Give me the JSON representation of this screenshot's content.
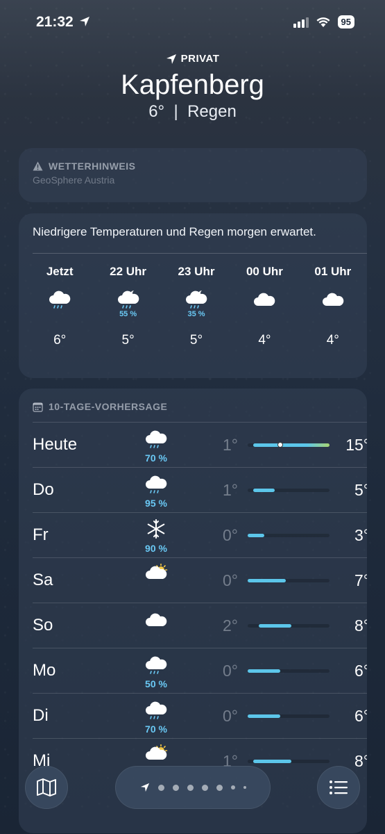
{
  "status": {
    "time": "21:32",
    "battery": "95"
  },
  "header": {
    "location_label": "PRIVAT",
    "city": "Kapfenberg",
    "temp": "6°",
    "separator": "|",
    "condition": "Regen"
  },
  "alert": {
    "title": "WETTERHINWEIS",
    "source": "GeoSphere Austria"
  },
  "hourly": {
    "description": "Niedrigere Temperaturen und Regen morgen erwartet.",
    "hours": [
      {
        "label": "Jetzt",
        "icon": "rain-cloud-icon",
        "pct": "",
        "temp": "6°"
      },
      {
        "label": "22 Uhr",
        "icon": "night-rain-icon",
        "pct": "55 %",
        "temp": "5°"
      },
      {
        "label": "23 Uhr",
        "icon": "night-rain-icon",
        "pct": "35 %",
        "temp": "5°"
      },
      {
        "label": "00 Uhr",
        "icon": "cloud-icon",
        "pct": "",
        "temp": "4°"
      },
      {
        "label": "01 Uhr",
        "icon": "cloud-icon",
        "pct": "",
        "temp": "4°"
      }
    ]
  },
  "forecast": {
    "title": "10-TAGE-VORHERSAGE",
    "range_min": 0,
    "range_max": 15,
    "days": [
      {
        "day": "Heute",
        "icon": "rain-cloud-icon",
        "pct": "70 %",
        "lo": "1°",
        "hi": "15°",
        "lo_v": 1,
        "hi_v": 15,
        "current": 6
      },
      {
        "day": "Do",
        "icon": "rain-cloud-icon",
        "pct": "95 %",
        "lo": "1°",
        "hi": "5°",
        "lo_v": 1,
        "hi_v": 5
      },
      {
        "day": "Fr",
        "icon": "snowflake-icon",
        "pct": "90 %",
        "lo": "0°",
        "hi": "3°",
        "lo_v": 0,
        "hi_v": 3
      },
      {
        "day": "Sa",
        "icon": "sun-cloud-icon",
        "pct": "",
        "lo": "0°",
        "hi": "7°",
        "lo_v": 0,
        "hi_v": 7
      },
      {
        "day": "So",
        "icon": "cloud-icon",
        "pct": "",
        "lo": "2°",
        "hi": "8°",
        "lo_v": 2,
        "hi_v": 8
      },
      {
        "day": "Mo",
        "icon": "rain-cloud-icon",
        "pct": "50 %",
        "lo": "0°",
        "hi": "6°",
        "lo_v": 0,
        "hi_v": 6
      },
      {
        "day": "Di",
        "icon": "rain-cloud-icon",
        "pct": "70 %",
        "lo": "0°",
        "hi": "6°",
        "lo_v": 0,
        "hi_v": 6
      },
      {
        "day": "Mi",
        "icon": "sun-cloud-icon",
        "pct": "",
        "lo": "1°",
        "hi": "8°",
        "lo_v": 1,
        "hi_v": 8
      }
    ]
  },
  "colors": {
    "accent": "#5cc6ea",
    "precip": "#6ac9f5",
    "warm": "#a8d572"
  }
}
